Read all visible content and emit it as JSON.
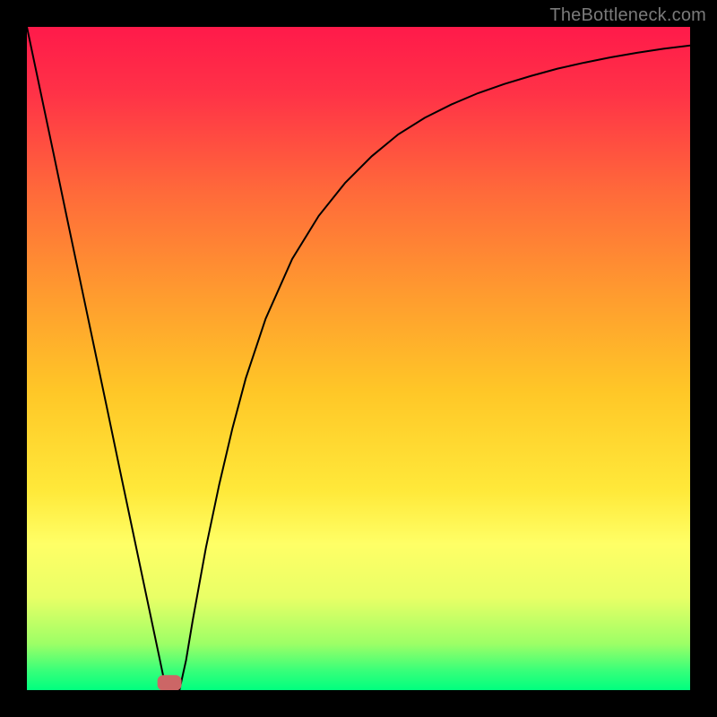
{
  "watermark": "TheBottleneck.com",
  "colors": {
    "frame": "#000000",
    "gradient_stops": [
      {
        "offset": 0.0,
        "color": "#ff1a4a"
      },
      {
        "offset": 0.1,
        "color": "#ff3247"
      },
      {
        "offset": 0.25,
        "color": "#ff6a3a"
      },
      {
        "offset": 0.4,
        "color": "#ff9a2f"
      },
      {
        "offset": 0.55,
        "color": "#ffc727"
      },
      {
        "offset": 0.7,
        "color": "#ffe93a"
      },
      {
        "offset": 0.78,
        "color": "#ffff66"
      },
      {
        "offset": 0.86,
        "color": "#e9ff66"
      },
      {
        "offset": 0.93,
        "color": "#9dff66"
      },
      {
        "offset": 0.972,
        "color": "#35ff7a"
      },
      {
        "offset": 1.0,
        "color": "#00ff7f"
      }
    ],
    "curve": "#000000",
    "marker_fill": "#cc6666",
    "marker_stroke": "#cc6666"
  },
  "chart_data": {
    "type": "line",
    "title": "",
    "xlabel": "",
    "ylabel": "",
    "xlim": [
      0,
      100
    ],
    "ylim": [
      0,
      100
    ],
    "x": [
      0,
      2,
      4,
      6,
      8,
      10,
      12,
      14,
      16,
      18,
      20,
      21,
      22,
      23,
      24,
      25,
      27,
      29,
      31,
      33,
      36,
      40,
      44,
      48,
      52,
      56,
      60,
      64,
      68,
      72,
      76,
      80,
      84,
      88,
      92,
      96,
      100
    ],
    "values": [
      100,
      90.5,
      81,
      71.4,
      61.9,
      52.4,
      42.9,
      33.3,
      23.8,
      14.3,
      4.8,
      0,
      0,
      0,
      4.5,
      10.5,
      21.5,
      31,
      39.5,
      47,
      56,
      65,
      71.5,
      76.5,
      80.5,
      83.8,
      86.3,
      88.3,
      90,
      91.4,
      92.6,
      93.7,
      94.6,
      95.4,
      96.1,
      96.7,
      97.2
    ],
    "marker": {
      "x_center": 21.5,
      "width": 3.5,
      "y": 0,
      "height": 2.2
    }
  }
}
